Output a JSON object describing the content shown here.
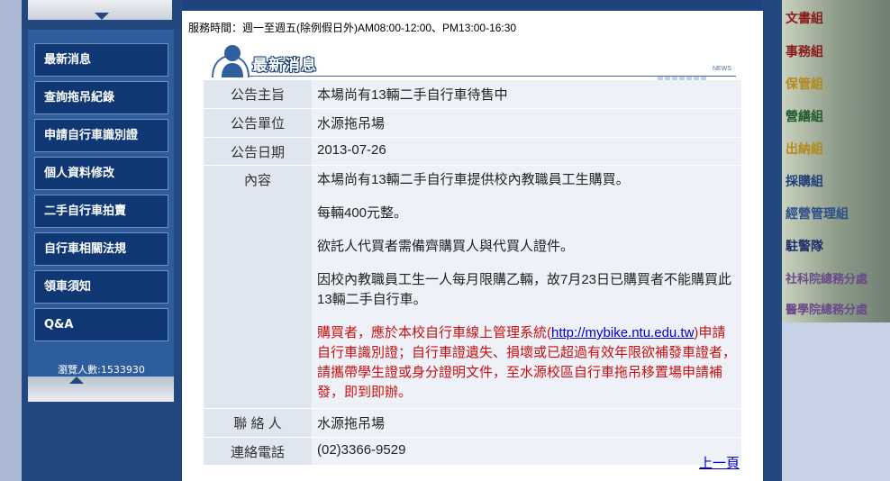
{
  "header": {
    "service_hours": "服務時間：週一至週五(除例假日外)AM08:00-12:00、PM13:00-16:30",
    "section_title": "最新消息",
    "section_tag": "NEWS"
  },
  "sidebar": {
    "items": [
      {
        "label": "最新消息"
      },
      {
        "label": "查詢拖吊紀錄"
      },
      {
        "label": "申請自行車識別證"
      },
      {
        "label": "個人資料修改"
      },
      {
        "label": "二手自行車拍賣"
      },
      {
        "label": "自行車相關法規"
      },
      {
        "label": "領車須知"
      },
      {
        "label": "Q&A"
      }
    ],
    "visitor_count": "瀏覽人數:1533930"
  },
  "announcement": {
    "subject_label": "公告主旨",
    "subject": "本場尚有13輛二手自行車待售中",
    "unit_label": "公告單位",
    "unit": "水源拖吊場",
    "date_label": "公告日期",
    "date": "2013-07-26",
    "content_label": "內容",
    "content_p1": "本場尚有13輛二手自行車提供校內教職員工生購買。",
    "content_p2": "每輛400元整。",
    "content_p3": "欲託人代買者需備齊購買人與代買人證件。",
    "content_p4": "因校內教職員工生一人每月限購乙輛，故7月23日已購買者不能購買此13輛二手自行車。",
    "notice_before_link": "購買者，應於本校自行車線上管理系統(",
    "notice_link": "http://mybike.ntu.edu.tw",
    "notice_after_link": ")申請自行車識別證；自行車證遺失、損壞或已超過有效年限欲補發車證者，請攜帶學生證或身分證明文件，至水源校區自行車拖吊移置場申請補發，即到即辦。",
    "contact_label": "聯 絡 人",
    "contact": "水源拖吊場",
    "phone_label": "連絡電話",
    "phone": "(02)3366-9529"
  },
  "footer": {
    "prev_page": "上一頁"
  },
  "right_nav": {
    "items": [
      {
        "label": "文書組",
        "color": "#8a1a1a"
      },
      {
        "label": "事務組",
        "color": "#8a1a1a"
      },
      {
        "label": "保管組",
        "color": "#b58a16"
      },
      {
        "label": "營繕組",
        "color": "#1f5c2a"
      },
      {
        "label": "出納組",
        "color": "#b58a16"
      },
      {
        "label": "採購組",
        "color": "#1f3f7c"
      },
      {
        "label": "經營管理組",
        "color": "#2c4f8a"
      },
      {
        "label": "駐警隊",
        "color": "#1f2f6c"
      },
      {
        "label": "社科院總務分處",
        "color": "#6a4a8a"
      },
      {
        "label": "醫學院總務分處",
        "color": "#6a4a8a"
      }
    ]
  }
}
